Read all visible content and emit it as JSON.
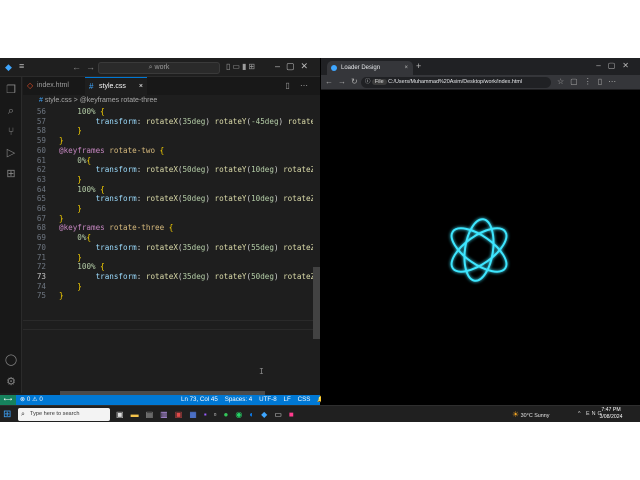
{
  "vscode": {
    "menu_icon": "≡",
    "search_text": "work",
    "tabs": [
      {
        "label": "index.html",
        "icon": "html-file-icon",
        "active": false
      },
      {
        "label": "style.css",
        "icon": "css-file-icon",
        "active": true,
        "close": "×"
      }
    ],
    "breadcrumb": {
      "file": "style.css",
      "separator": ">",
      "symbol": "@keyframes rotate-three"
    },
    "editor_lines": [
      {
        "n": "56",
        "indent": "    ",
        "parts": [
          [
            "n",
            "100%"
          ],
          [
            "p",
            " "
          ],
          [
            "b",
            "{"
          ]
        ]
      },
      {
        "n": "57",
        "indent": "        ",
        "parts": [
          [
            "pr",
            "transform"
          ],
          [
            "p",
            ": "
          ],
          [
            "f",
            "rotateX"
          ],
          [
            "p",
            "("
          ],
          [
            "n",
            "35deg"
          ],
          [
            "p",
            ") "
          ],
          [
            "f",
            "rotateY"
          ],
          [
            "p",
            "("
          ],
          [
            "n",
            "-45deg"
          ],
          [
            "p",
            ") "
          ],
          [
            "f",
            "rotateZ"
          ],
          [
            "p",
            "(3"
          ]
        ]
      },
      {
        "n": "58",
        "indent": "    ",
        "parts": [
          [
            "b",
            "}"
          ]
        ]
      },
      {
        "n": "59",
        "indent": "",
        "parts": [
          [
            "b",
            "}"
          ]
        ]
      },
      {
        "n": "60",
        "indent": "",
        "parts": [
          [
            "k",
            "@keyframes"
          ],
          [
            "p",
            " "
          ],
          [
            "s",
            "rotate-two"
          ],
          [
            "p",
            " "
          ],
          [
            "b",
            "{"
          ]
        ]
      },
      {
        "n": "61",
        "indent": "    ",
        "parts": [
          [
            "n",
            "0%"
          ],
          [
            "b",
            "{"
          ]
        ]
      },
      {
        "n": "62",
        "indent": "        ",
        "parts": [
          [
            "pr",
            "transform"
          ],
          [
            "p",
            ": "
          ],
          [
            "f",
            "rotateX"
          ],
          [
            "p",
            "("
          ],
          [
            "n",
            "50deg"
          ],
          [
            "p",
            ") "
          ],
          [
            "f",
            "rotateY"
          ],
          [
            "p",
            "("
          ],
          [
            "n",
            "10deg"
          ],
          [
            "p",
            ") "
          ],
          [
            "f",
            "rotateZ"
          ],
          [
            "p",
            "(0d"
          ]
        ]
      },
      {
        "n": "63",
        "indent": "    ",
        "parts": [
          [
            "b",
            "}"
          ]
        ]
      },
      {
        "n": "64",
        "indent": "    ",
        "parts": [
          [
            "n",
            "100%"
          ],
          [
            "p",
            " "
          ],
          [
            "b",
            "{"
          ]
        ]
      },
      {
        "n": "65",
        "indent": "        ",
        "parts": [
          [
            "pr",
            "transform"
          ],
          [
            "p",
            ": "
          ],
          [
            "f",
            "rotateX"
          ],
          [
            "p",
            "("
          ],
          [
            "n",
            "50deg"
          ],
          [
            "p",
            ") "
          ],
          [
            "f",
            "rotateY"
          ],
          [
            "p",
            "("
          ],
          [
            "n",
            "10deg"
          ],
          [
            "p",
            ") "
          ],
          [
            "f",
            "rotateZ"
          ],
          [
            "p",
            "(36"
          ]
        ]
      },
      {
        "n": "66",
        "indent": "    ",
        "parts": [
          [
            "b",
            "}"
          ]
        ]
      },
      {
        "n": "67",
        "indent": "",
        "parts": [
          [
            "b",
            "}"
          ]
        ]
      },
      {
        "n": "68",
        "indent": "",
        "parts": [
          [
            "k",
            "@keyframes"
          ],
          [
            "p",
            " "
          ],
          [
            "s",
            "rotate-three"
          ],
          [
            "p",
            " "
          ],
          [
            "b",
            "{"
          ]
        ]
      },
      {
        "n": "69",
        "indent": "    ",
        "parts": [
          [
            "n",
            "0%"
          ],
          [
            "b",
            "{"
          ]
        ]
      },
      {
        "n": "70",
        "indent": "        ",
        "parts": [
          [
            "pr",
            "transform"
          ],
          [
            "p",
            ": "
          ],
          [
            "f",
            "rotateX"
          ],
          [
            "p",
            "("
          ],
          [
            "n",
            "35deg"
          ],
          [
            "p",
            ") "
          ],
          [
            "f",
            "rotateY"
          ],
          [
            "p",
            "("
          ],
          [
            "n",
            "55deg"
          ],
          [
            "p",
            ") "
          ],
          [
            "f",
            "rotateZ"
          ],
          [
            "p",
            "(0d"
          ]
        ]
      },
      {
        "n": "71",
        "indent": "    ",
        "parts": [
          [
            "b",
            "}"
          ]
        ]
      },
      {
        "n": "72",
        "indent": "    ",
        "parts": [
          [
            "n",
            "100%"
          ],
          [
            "p",
            " "
          ],
          [
            "b",
            "{"
          ]
        ]
      },
      {
        "n": "73",
        "indent": "        ",
        "parts": [
          [
            "pr",
            "transform"
          ],
          [
            "p",
            ": "
          ],
          [
            "f",
            "rotateX"
          ],
          [
            "p",
            "("
          ],
          [
            "n",
            "35deg"
          ],
          [
            "p",
            ") "
          ],
          [
            "f",
            "rotateY"
          ],
          [
            "p",
            "("
          ],
          [
            "n",
            "50deg"
          ],
          [
            "p",
            ") "
          ],
          [
            "f",
            "rotateZ"
          ],
          [
            "p",
            "(36"
          ]
        ]
      },
      {
        "n": "74",
        "indent": "    ",
        "parts": [
          [
            "b",
            "}"
          ]
        ]
      },
      {
        "n": "75",
        "indent": "",
        "parts": [
          [
            "b",
            "}"
          ]
        ]
      }
    ],
    "current_line": "73",
    "status": {
      "problems": "⊗ 0 ⚠ 0",
      "position": "Ln 73, Col 45",
      "spaces": "Spaces: 4",
      "encoding": "UTF-8",
      "eol": "LF",
      "language": "CSS"
    },
    "accent": "#0078d4"
  },
  "browser": {
    "tab_title": "Loader Design",
    "close": "×",
    "new_tab": "+",
    "file_chip": "File",
    "address": "C:/Users/Muhammad%20Asim/Desktop/work/index.html",
    "loader_color": "#3ee6ff"
  },
  "taskbar": {
    "search_placeholder": "Type here to search",
    "weather": "30°C  Sunny",
    "lang": "ENG",
    "time": "7:47 PM",
    "date": "3/08/2024"
  }
}
